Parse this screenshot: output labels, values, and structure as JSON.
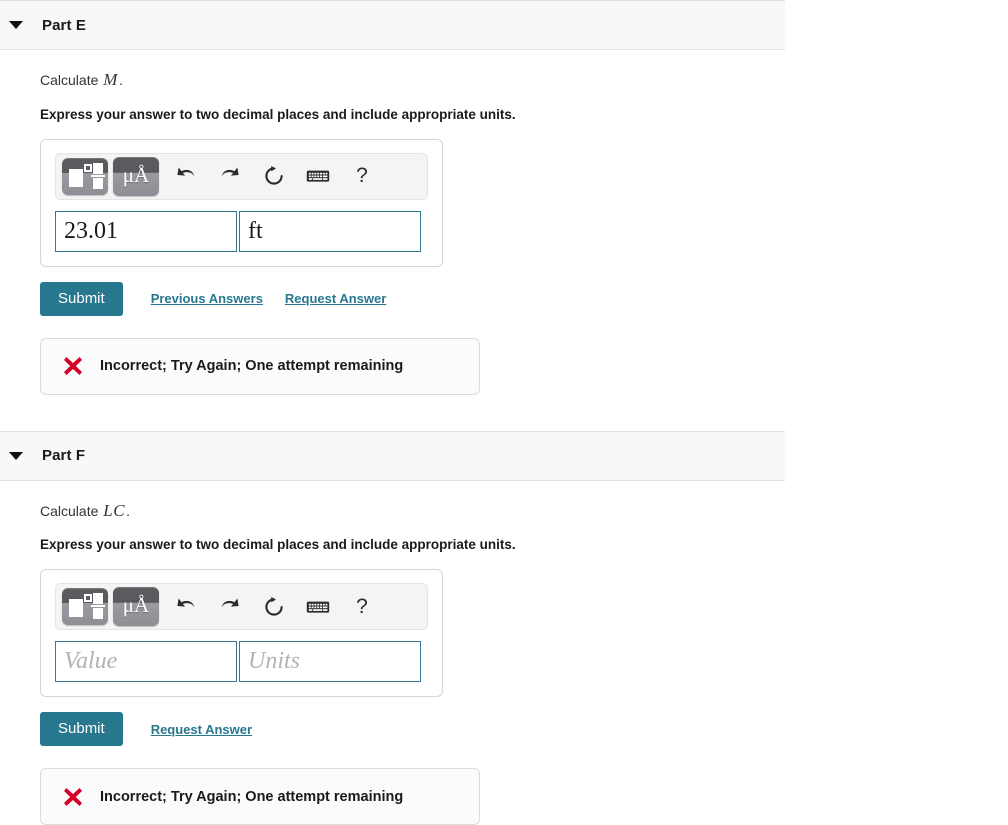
{
  "parts": [
    {
      "id": "part-e",
      "title": "Part E",
      "caret_icon": "chevron-down-icon",
      "prompt_prefix": "Calculate ",
      "prompt_variable": "M",
      "prompt_suffix": ".",
      "instruction": "Express your answer to two decimal places and include appropriate units.",
      "toolbar": {
        "template_button": "math-template-icon",
        "units_button": "μÅ",
        "undo_icon": "undo-icon",
        "redo_icon": "redo-icon",
        "reset_icon": "reset-icon",
        "keyboard_icon": "keyboard-icon",
        "help_icon": "?"
      },
      "value_field": {
        "value": "23.01",
        "placeholder": "Value",
        "filled": true
      },
      "units_field": {
        "value": "ft",
        "placeholder": "Units",
        "filled": true
      },
      "submit_label": "Submit",
      "links": [
        "Previous Answers",
        "Request Answer"
      ],
      "feedback": {
        "icon": "error-x-icon",
        "text": "Incorrect; Try Again; One attempt remaining"
      }
    },
    {
      "id": "part-f",
      "title": "Part F",
      "caret_icon": "chevron-down-icon",
      "prompt_prefix": "Calculate ",
      "prompt_variable": "LC",
      "prompt_suffix": ".",
      "instruction": "Express your answer to two decimal places and include appropriate units.",
      "toolbar": {
        "template_button": "math-template-icon",
        "units_button": "μÅ",
        "undo_icon": "undo-icon",
        "redo_icon": "redo-icon",
        "reset_icon": "reset-icon",
        "keyboard_icon": "keyboard-icon",
        "help_icon": "?"
      },
      "value_field": {
        "value": "",
        "placeholder": "Value",
        "filled": false
      },
      "units_field": {
        "value": "",
        "placeholder": "Units",
        "filled": false
      },
      "submit_label": "Submit",
      "links": [
        "Request Answer"
      ],
      "feedback": {
        "icon": "error-x-icon",
        "text": "Incorrect; Try Again; One attempt remaining"
      }
    }
  ],
  "colors": {
    "accent": "#27788f",
    "field_border": "#337a93",
    "header_bg": "#f8f8f8",
    "error_red": "#d60026",
    "toolbar_bg": "#f4f4f4"
  }
}
